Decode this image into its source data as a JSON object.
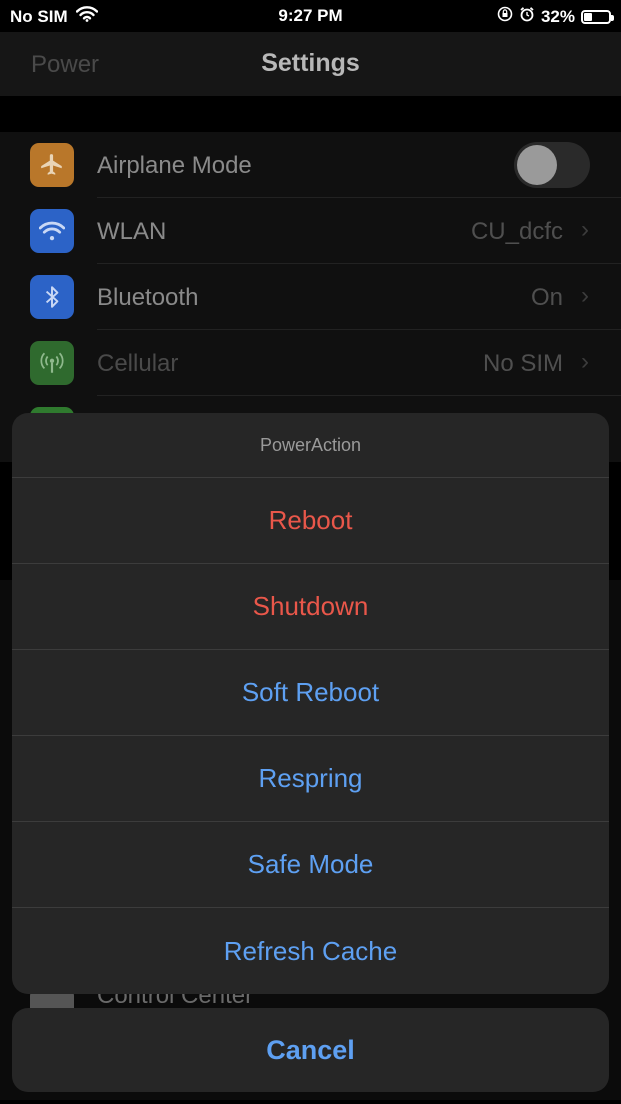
{
  "status_bar": {
    "carrier": "No SIM",
    "time": "9:27 PM",
    "battery_percent": "32%",
    "battery_level": 0.32,
    "icons": [
      "wifi-icon",
      "orientation-lock-icon",
      "alarm-icon",
      "battery-icon"
    ]
  },
  "nav": {
    "back_label": "Power",
    "title": "Settings"
  },
  "settings": {
    "rows": [
      {
        "label": "Airplane Mode",
        "icon": "airplane-icon",
        "icon_color": "#b9772a",
        "toggle_on": false
      },
      {
        "label": "WLAN",
        "value": "CU_dcfc",
        "icon": "wifi-icon",
        "icon_color": "#2c63c7"
      },
      {
        "label": "Bluetooth",
        "value": "On",
        "icon": "bluetooth-icon",
        "icon_color": "#2c63c7"
      },
      {
        "label": "Cellular",
        "value": "No SIM",
        "icon": "antenna-icon",
        "icon_color": "#2f6a2e"
      }
    ],
    "partial_row_label": "Control Center"
  },
  "action_sheet": {
    "title": "PowerAction",
    "items": [
      {
        "label": "Reboot",
        "style": "destructive"
      },
      {
        "label": "Shutdown",
        "style": "destructive"
      },
      {
        "label": "Soft Reboot",
        "style": "default"
      },
      {
        "label": "Respring",
        "style": "default"
      },
      {
        "label": "Safe Mode",
        "style": "default"
      },
      {
        "label": "Refresh Cache",
        "style": "default"
      }
    ],
    "cancel_label": "Cancel"
  },
  "colors": {
    "destructive": "#e9574a",
    "accent": "#5ea0f2",
    "sheet_bg": "#262626"
  }
}
